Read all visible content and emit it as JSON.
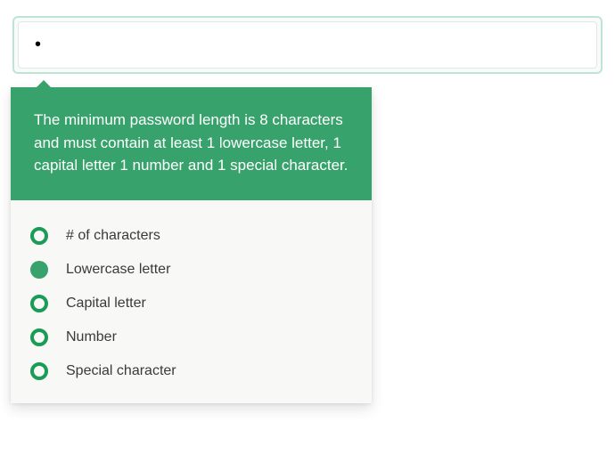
{
  "input": {
    "value": "•",
    "placeholder": ""
  },
  "popover": {
    "instructions": "The minimum password length is 8 characters and must contain at least 1 lowercase letter, 1 capital letter 1 number and 1 special character."
  },
  "rules": [
    {
      "label": "# of characters",
      "met": false
    },
    {
      "label": "Lowercase letter",
      "met": true
    },
    {
      "label": "Capital letter",
      "met": false
    },
    {
      "label": "Number",
      "met": false
    },
    {
      "label": "Special character",
      "met": false
    }
  ],
  "colors": {
    "accent": "#37a26b",
    "ring": "#1a9c56"
  }
}
